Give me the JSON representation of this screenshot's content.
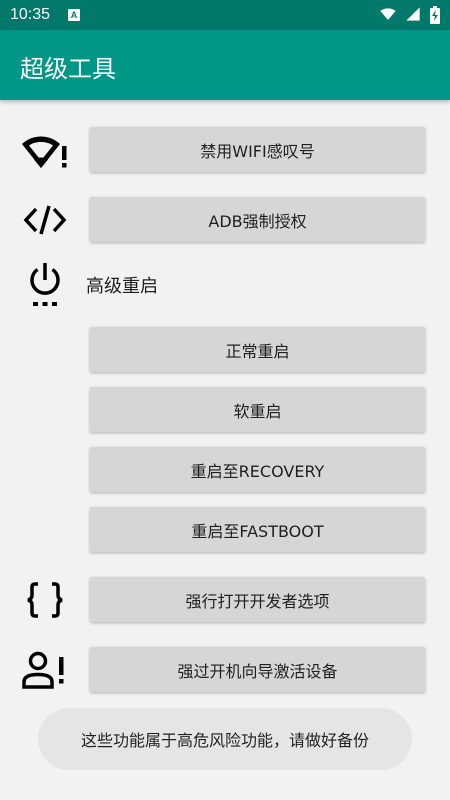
{
  "status_bar": {
    "time": "10:35",
    "notification_icon": "A",
    "icons": [
      "wifi-icon",
      "signal-icon",
      "battery-charging-icon"
    ]
  },
  "app_bar": {
    "title": "超级工具"
  },
  "colors": {
    "primary": "#009688",
    "primary_dark": "#00796b",
    "button_bg": "#d6d6d6",
    "background": "#f2f2f2"
  },
  "actions": {
    "disable_wifi_exclaim": "禁用WIFI感叹号",
    "adb_force_auth": "ADB强制授权",
    "advanced_reboot_label": "高级重启",
    "reboot_normal": "正常重启",
    "reboot_soft": "软重启",
    "reboot_recovery": "重启至RECOVERY",
    "reboot_fastboot": "重启至FASTBOOT",
    "force_developer_options": "强行打开开发者选项",
    "bypass_setup_wizard": "强过开机向导激活设备"
  },
  "toast": {
    "message": "这些功能属于高危风险功能，请做好备份"
  }
}
